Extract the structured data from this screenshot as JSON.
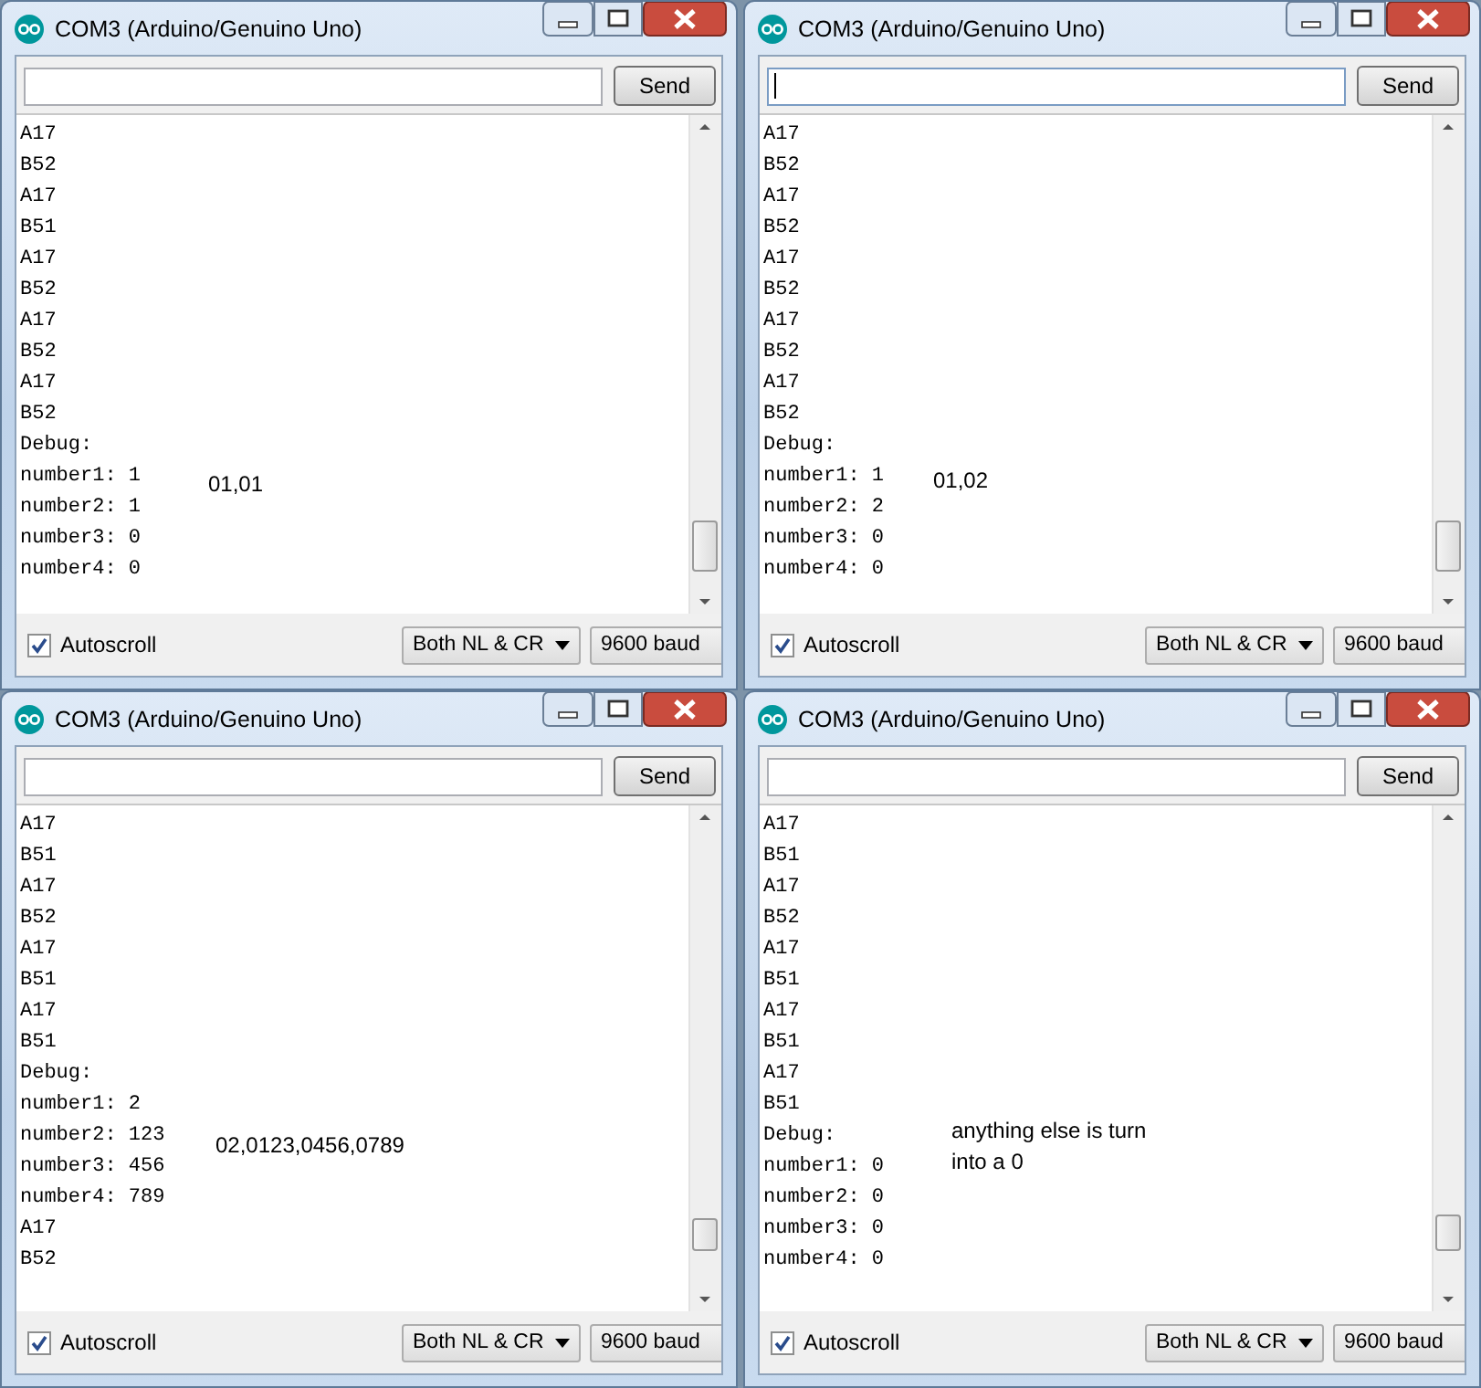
{
  "windows": [
    {
      "title": "COM3 (Arduino/Genuino Uno)",
      "input": {
        "focused": false
      },
      "send": "Send",
      "lines": [
        "A17",
        "B52",
        "A17",
        "B51",
        "A17",
        "B52",
        "A17",
        "B52",
        "A17",
        "B52",
        "Debug:",
        "number1: 1",
        "number2: 1",
        "number3: 0",
        "number4: 0"
      ],
      "note": "01,01",
      "autoscroll": {
        "label": "Autoscroll",
        "checked": true
      },
      "line_ending": "Both NL & CR",
      "baud": "9600 baud"
    },
    {
      "title": "COM3 (Arduino/Genuino Uno)",
      "input": {
        "focused": true
      },
      "send": "Send",
      "lines": [
        "A17",
        "B52",
        "A17",
        "B52",
        "A17",
        "B52",
        "A17",
        "B52",
        "A17",
        "B52",
        "Debug:",
        "number1: 1",
        "number2: 2",
        "number3: 0",
        "number4: 0"
      ],
      "note": "01,02",
      "autoscroll": {
        "label": "Autoscroll",
        "checked": true
      },
      "line_ending": "Both NL & CR",
      "baud": "9600 baud"
    },
    {
      "title": "COM3 (Arduino/Genuino Uno)",
      "input": {
        "focused": false
      },
      "send": "Send",
      "lines": [
        "A17",
        "B51",
        "A17",
        "B52",
        "A17",
        "B51",
        "A17",
        "B51",
        "Debug:",
        "number1: 2",
        "number2: 123",
        "number3: 456",
        "number4: 789",
        "A17",
        "B52"
      ],
      "note": "02,0123,0456,0789",
      "autoscroll": {
        "label": "Autoscroll",
        "checked": true
      },
      "line_ending": "Both NL & CR",
      "baud": "9600 baud"
    },
    {
      "title": "COM3 (Arduino/Genuino Uno)",
      "input": {
        "focused": false
      },
      "send": "Send",
      "lines": [
        "A17",
        "B51",
        "A17",
        "B52",
        "A17",
        "B51",
        "A17",
        "B51",
        "A17",
        "B51",
        "Debug:",
        "number1: 0",
        "number2: 0",
        "number3: 0",
        "number4: 0"
      ],
      "note": "anything else is turn\ninto a 0",
      "autoscroll": {
        "label": "Autoscroll",
        "checked": true
      },
      "line_ending": "Both NL & CR",
      "baud": "9600 baud"
    }
  ]
}
